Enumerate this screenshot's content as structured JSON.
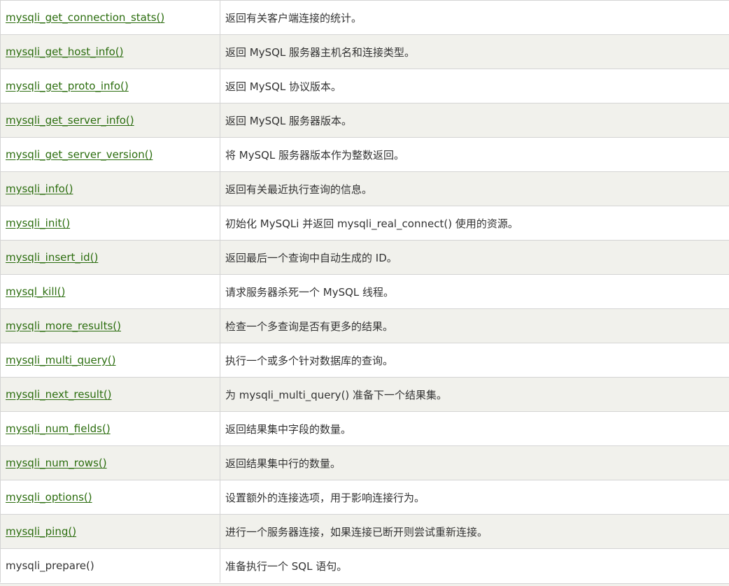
{
  "rows": [
    {
      "func": "mysqli_get_connection_stats()",
      "desc": "返回有关客户端连接的统计。",
      "link": true
    },
    {
      "func": "mysqli_get_host_info()",
      "desc": "返回 MySQL 服务器主机名和连接类型。",
      "link": true
    },
    {
      "func": "mysqli_get_proto_info()",
      "desc": "返回 MySQL 协议版本。",
      "link": true
    },
    {
      "func": "mysqli_get_server_info()",
      "desc": "返回 MySQL 服务器版本。",
      "link": true
    },
    {
      "func": "mysqli_get_server_version()",
      "desc": "将 MySQL 服务器版本作为整数返回。",
      "link": true
    },
    {
      "func": "mysqli_info()",
      "desc": "返回有关最近执行查询的信息。",
      "link": true
    },
    {
      "func": "mysqli_init()",
      "desc": "初始化 MySQLi 并返回 mysqli_real_connect() 使用的资源。",
      "link": true
    },
    {
      "func": "mysqli_insert_id()",
      "desc": "返回最后一个查询中自动生成的 ID。",
      "link": true
    },
    {
      "func": "mysql_kill()",
      "desc": "请求服务器杀死一个 MySQL 线程。",
      "link": true
    },
    {
      "func": "mysqli_more_results()",
      "desc": "检查一个多查询是否有更多的结果。",
      "link": true
    },
    {
      "func": "mysqli_multi_query()",
      "desc": "执行一个或多个针对数据库的查询。",
      "link": true
    },
    {
      "func": "mysqli_next_result()",
      "desc": "为 mysqli_multi_query() 准备下一个结果集。",
      "link": true
    },
    {
      "func": "mysqli_num_fields()",
      "desc": "返回结果集中字段的数量。",
      "link": true
    },
    {
      "func": "mysqli_num_rows()",
      "desc": "返回结果集中行的数量。",
      "link": true
    },
    {
      "func": "mysqli_options()",
      "desc": "设置额外的连接选项，用于影响连接行为。",
      "link": true
    },
    {
      "func": "mysqli_ping()",
      "desc": "进行一个服务器连接，如果连接已断开则尝试重新连接。",
      "link": true
    },
    {
      "func": "mysqli_prepare()",
      "desc": "准备执行一个 SQL 语句。",
      "link": false
    }
  ],
  "colors": {
    "link": "#2b6d0e",
    "text": "#333333",
    "row_alt": "#f1f1ec",
    "border": "#d4d4d4"
  }
}
